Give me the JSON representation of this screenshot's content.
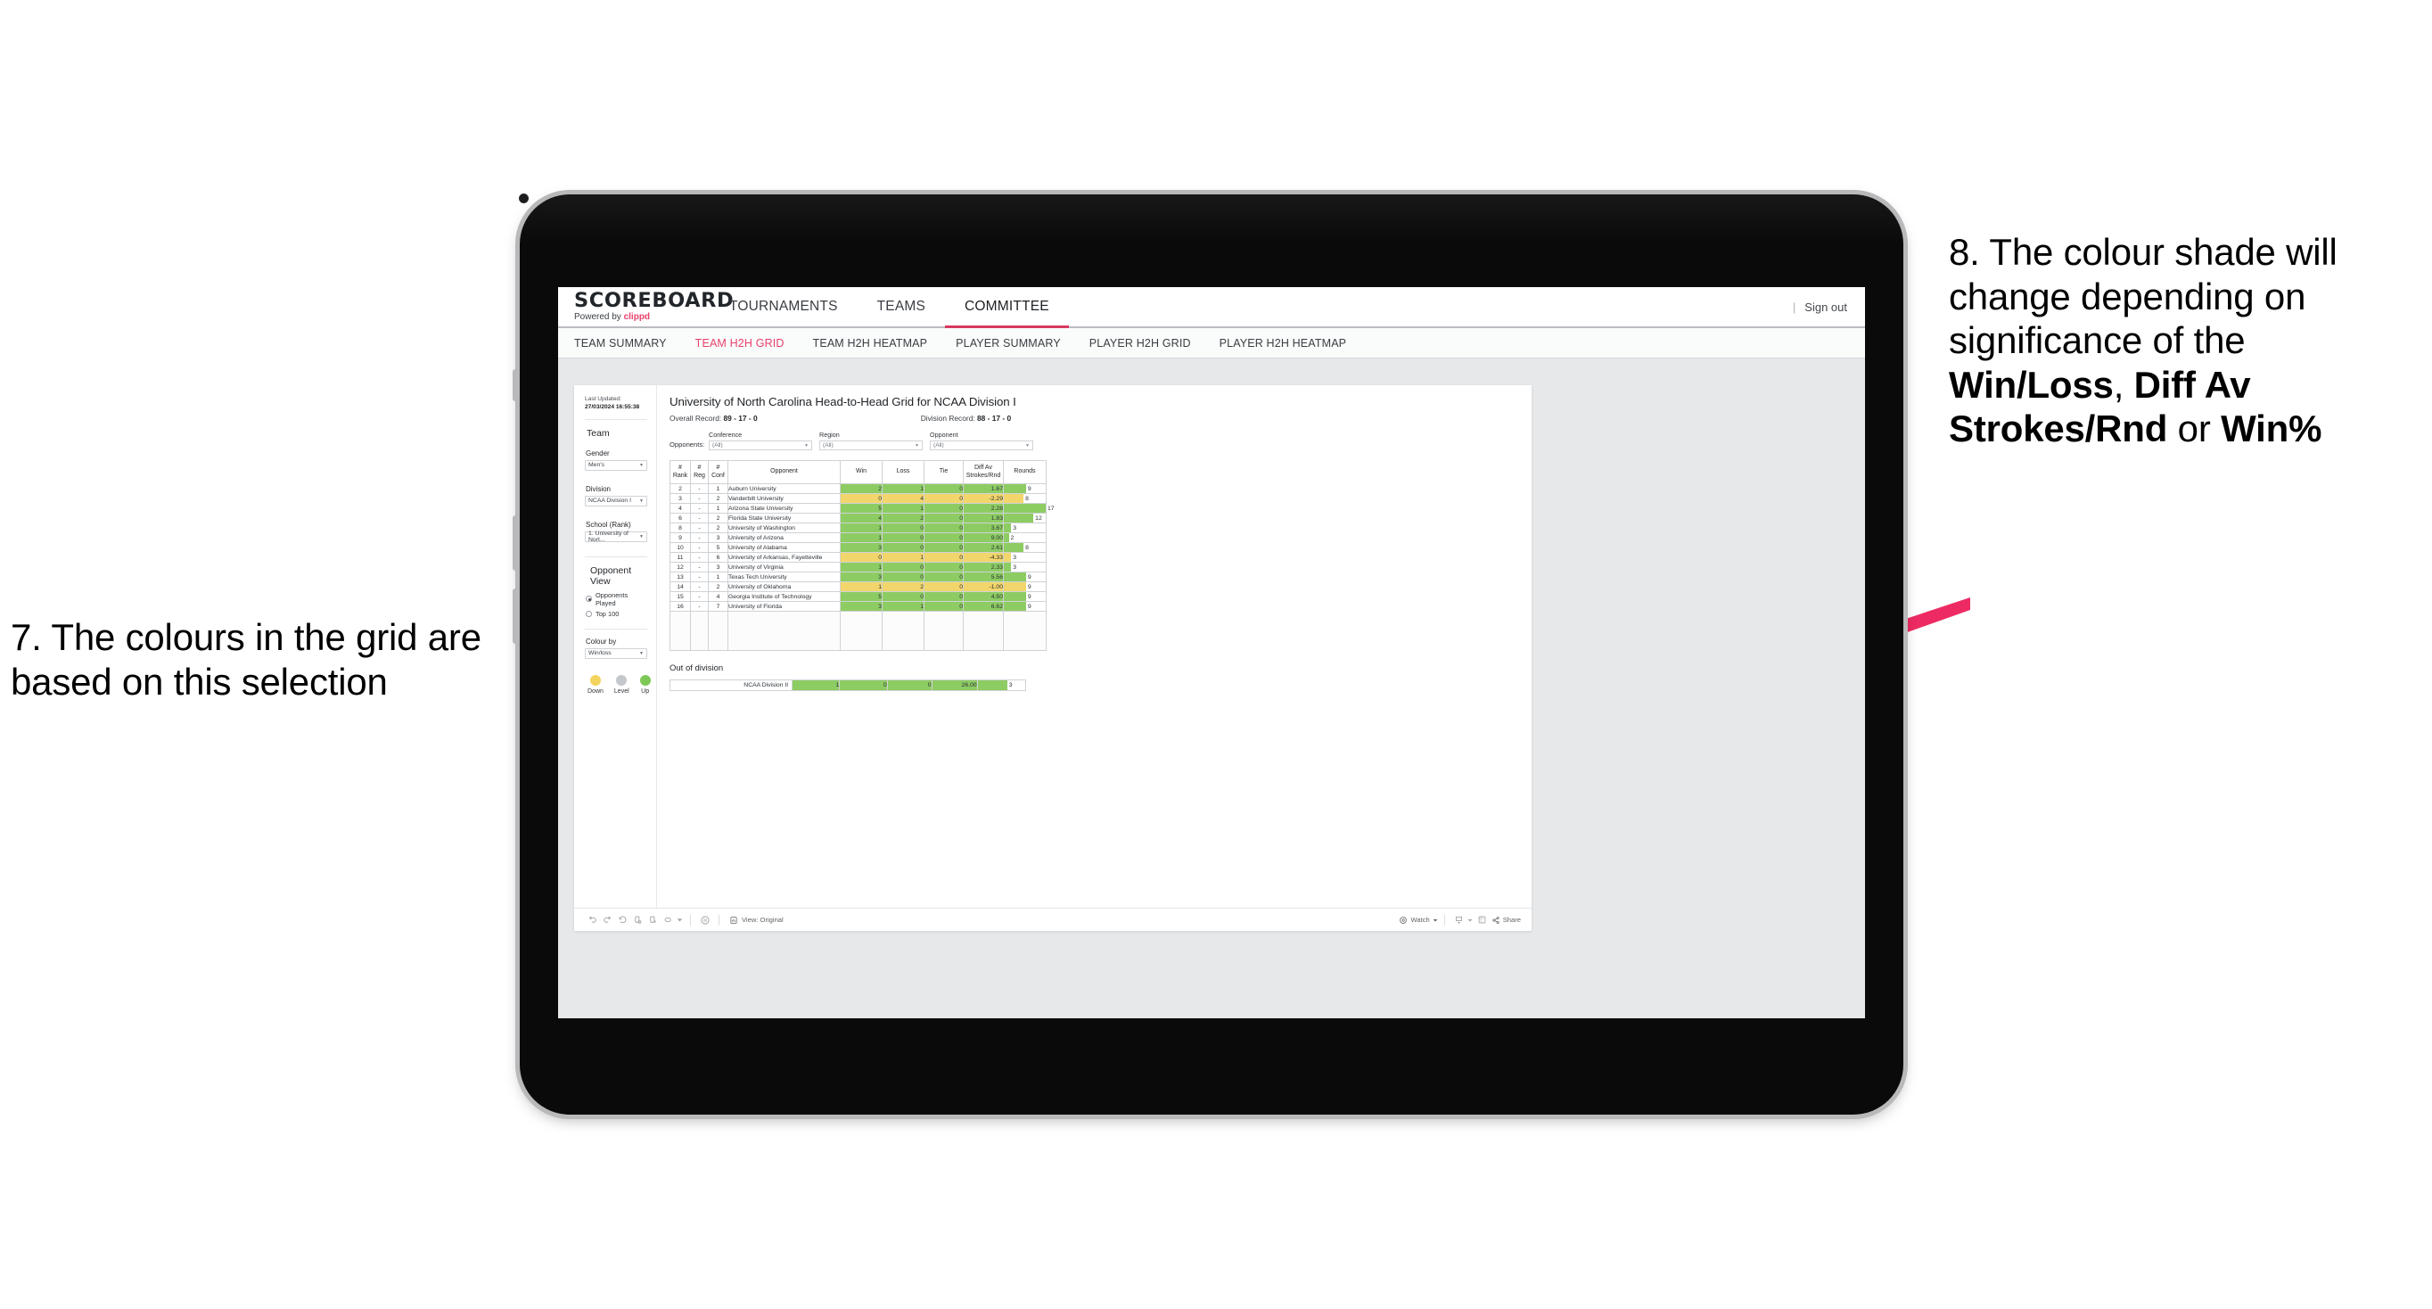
{
  "annotations": {
    "left": {
      "number": "7.",
      "text": "The colours in the grid are based on this selection"
    },
    "right": {
      "number": "8.",
      "part1": "The colour shade will change depending on significance of the ",
      "bold1": "Win/Loss",
      "mid1": ", ",
      "bold2": "Diff Av Strokes/Rnd",
      "mid2": " or ",
      "bold3": "Win%"
    },
    "arrow_color": "#ED2B62"
  },
  "app": {
    "brand": {
      "name": "SCOREBOARD",
      "powered_prefix": "Powered by ",
      "powered_brand": "clippd"
    },
    "nav": [
      {
        "label": "TOURNAMENTS",
        "active": false
      },
      {
        "label": "TEAMS",
        "active": false
      },
      {
        "label": "COMMITTEE",
        "active": true
      }
    ],
    "signout": {
      "divider": "|",
      "label": "Sign out"
    },
    "subnav": [
      {
        "label": "TEAM SUMMARY",
        "active": false
      },
      {
        "label": "TEAM H2H GRID",
        "active": true
      },
      {
        "label": "TEAM H2H HEATMAP",
        "active": false
      },
      {
        "label": "PLAYER SUMMARY",
        "active": false
      },
      {
        "label": "PLAYER H2H GRID",
        "active": false
      },
      {
        "label": "PLAYER H2H HEATMAP",
        "active": false
      }
    ]
  },
  "filters": {
    "last_updated_label": "Last Updated: ",
    "last_updated_value": "27/03/2024 16:55:38",
    "team_heading": "Team",
    "gender": {
      "label": "Gender",
      "value": "Men's"
    },
    "division": {
      "label": "Division",
      "value": "NCAA Division I"
    },
    "school": {
      "label": "School (Rank)",
      "value": "1. University of Nort..."
    },
    "opponent_view": {
      "heading": "Opponent View",
      "options": [
        {
          "label": "Opponents Played",
          "selected": true
        },
        {
          "label": "Top 100",
          "selected": false
        }
      ]
    },
    "colour_by": {
      "label": "Colour by",
      "value": "Win/loss"
    },
    "legend": [
      {
        "label": "Down",
        "color": "#F2D45E"
      },
      {
        "label": "Level",
        "color": "#C4C7CC"
      },
      {
        "label": "Up",
        "color": "#7EC855"
      }
    ]
  },
  "viz": {
    "title": "University of North Carolina Head-to-Head Grid for NCAA Division I",
    "overall_record_label": "Overall Record: ",
    "overall_record_value": "89 - 17 - 0",
    "division_record_label": "Division Record: ",
    "division_record_value": "88 - 17 - 0",
    "opponents_label": "Opponents:",
    "opponent_filters": [
      {
        "label": "Conference",
        "value": "(All)"
      },
      {
        "label": "Region",
        "value": "(All)"
      },
      {
        "label": "Opponent",
        "value": "(All)"
      }
    ],
    "out_of_division_title": "Out of division",
    "out_of_division_row": {
      "label": "NCAA Division II",
      "win": "1",
      "loss": "0",
      "tie": "0",
      "diff": "26.00",
      "rounds": "3",
      "color": "up"
    },
    "toolbar": {
      "view_label": "View: Original",
      "watch_label": "Watch",
      "share_label": "Share"
    }
  },
  "chart_data": {
    "type": "table",
    "title": "University of North Carolina Head-to-Head Grid for NCAA Division I",
    "columns": [
      "# Rank",
      "# Reg",
      "# Conf",
      "Opponent",
      "Win",
      "Loss",
      "Tie",
      "Diff Av Strokes/Rnd",
      "Rounds"
    ],
    "column_headers": [
      {
        "line1": "#",
        "line2": "Rank"
      },
      {
        "line1": "#",
        "line2": "Reg"
      },
      {
        "line1": "#",
        "line2": "Conf"
      },
      {
        "line1": "Opponent",
        "line2": ""
      },
      {
        "line1": "Win",
        "line2": ""
      },
      {
        "line1": "Loss",
        "line2": ""
      },
      {
        "line1": "Tie",
        "line2": ""
      },
      {
        "line1": "Diff Av",
        "line2": "Strokes/Rnd"
      },
      {
        "line1": "Rounds",
        "line2": ""
      }
    ],
    "rounds_max": 17,
    "colors": {
      "up": "#8DCC63",
      "down": "#F2D66B",
      "level": "#C4C7CC"
    },
    "rows": [
      {
        "rank": "2",
        "reg": "-",
        "conf": "1",
        "opponent": "Auburn University",
        "win": "2",
        "loss": "1",
        "tie": "0",
        "diff": "1.67",
        "rounds": "9",
        "color": "up"
      },
      {
        "rank": "3",
        "reg": "-",
        "conf": "2",
        "opponent": "Vanderbilt University",
        "win": "0",
        "loss": "4",
        "tie": "0",
        "diff": "-2.29",
        "rounds": "8",
        "color": "down"
      },
      {
        "rank": "4",
        "reg": "-",
        "conf": "1",
        "opponent": "Arizona State University",
        "win": "5",
        "loss": "1",
        "tie": "0",
        "diff": "2.28",
        "rounds": "17",
        "color": "up"
      },
      {
        "rank": "6",
        "reg": "-",
        "conf": "2",
        "opponent": "Florida State University",
        "win": "4",
        "loss": "2",
        "tie": "0",
        "diff": "1.83",
        "rounds": "12",
        "color": "up"
      },
      {
        "rank": "8",
        "reg": "-",
        "conf": "2",
        "opponent": "University of Washington",
        "win": "1",
        "loss": "0",
        "tie": "0",
        "diff": "3.67",
        "rounds": "3",
        "color": "up"
      },
      {
        "rank": "9",
        "reg": "-",
        "conf": "3",
        "opponent": "University of Arizona",
        "win": "1",
        "loss": "0",
        "tie": "0",
        "diff": "9.00",
        "rounds": "2",
        "color": "up"
      },
      {
        "rank": "10",
        "reg": "-",
        "conf": "5",
        "opponent": "University of Alabama",
        "win": "3",
        "loss": "0",
        "tie": "0",
        "diff": "2.61",
        "rounds": "8",
        "color": "up"
      },
      {
        "rank": "11",
        "reg": "-",
        "conf": "6",
        "opponent": "University of Arkansas, Fayetteville",
        "win": "0",
        "loss": "1",
        "tie": "0",
        "diff": "-4.33",
        "rounds": "3",
        "color": "down"
      },
      {
        "rank": "12",
        "reg": "-",
        "conf": "3",
        "opponent": "University of Virginia",
        "win": "1",
        "loss": "0",
        "tie": "0",
        "diff": "2.33",
        "rounds": "3",
        "color": "up"
      },
      {
        "rank": "13",
        "reg": "-",
        "conf": "1",
        "opponent": "Texas Tech University",
        "win": "3",
        "loss": "0",
        "tie": "0",
        "diff": "5.56",
        "rounds": "9",
        "color": "up"
      },
      {
        "rank": "14",
        "reg": "-",
        "conf": "2",
        "opponent": "University of Oklahoma",
        "win": "1",
        "loss": "2",
        "tie": "0",
        "diff": "-1.00",
        "rounds": "9",
        "color": "down"
      },
      {
        "rank": "15",
        "reg": "-",
        "conf": "4",
        "opponent": "Georgia Institute of Technology",
        "win": "5",
        "loss": "0",
        "tie": "0",
        "diff": "4.50",
        "rounds": "9",
        "color": "up"
      },
      {
        "rank": "16",
        "reg": "-",
        "conf": "7",
        "opponent": "University of Florida",
        "win": "3",
        "loss": "1",
        "tie": "0",
        "diff": "6.62",
        "rounds": "9",
        "color": "up"
      }
    ]
  }
}
